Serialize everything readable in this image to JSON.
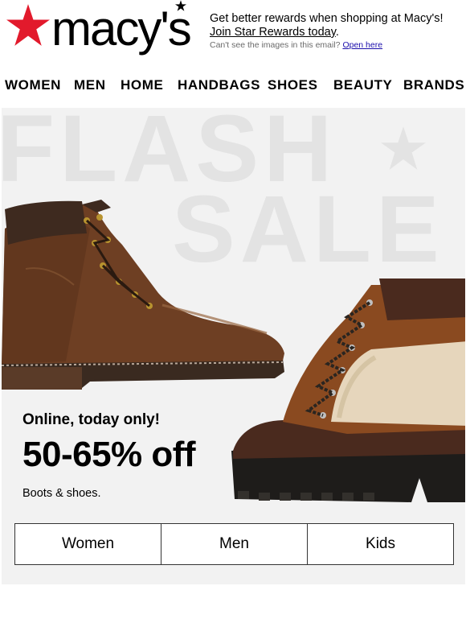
{
  "logo": {
    "wordmark": "macy's",
    "icon": "star-icon",
    "brand_color": "#e21a2c"
  },
  "promo": {
    "line1": "Get better rewards when shopping at Macy's!",
    "link": "Join Star Rewards today",
    "link_suffix": ".",
    "small_text": "Can't see the images in this email?",
    "small_link": "Open here"
  },
  "nav": {
    "items": [
      {
        "label": "WOMEN"
      },
      {
        "label": "MEN"
      },
      {
        "label": "HOME"
      },
      {
        "label": "HANDBAGS"
      },
      {
        "label": "SHOES"
      },
      {
        "label": "BEAUTY"
      },
      {
        "label": "BRANDS"
      }
    ]
  },
  "hero": {
    "bg_word_1": "FLASH",
    "bg_word_2": "SALE",
    "bg_color": "#f2f2f2",
    "eyebrow": "Online, today only!",
    "headline": "50-65% off",
    "subtext": "Boots & shoes.",
    "buttons": [
      {
        "label": "Women"
      },
      {
        "label": "Men"
      },
      {
        "label": "Kids"
      }
    ]
  }
}
